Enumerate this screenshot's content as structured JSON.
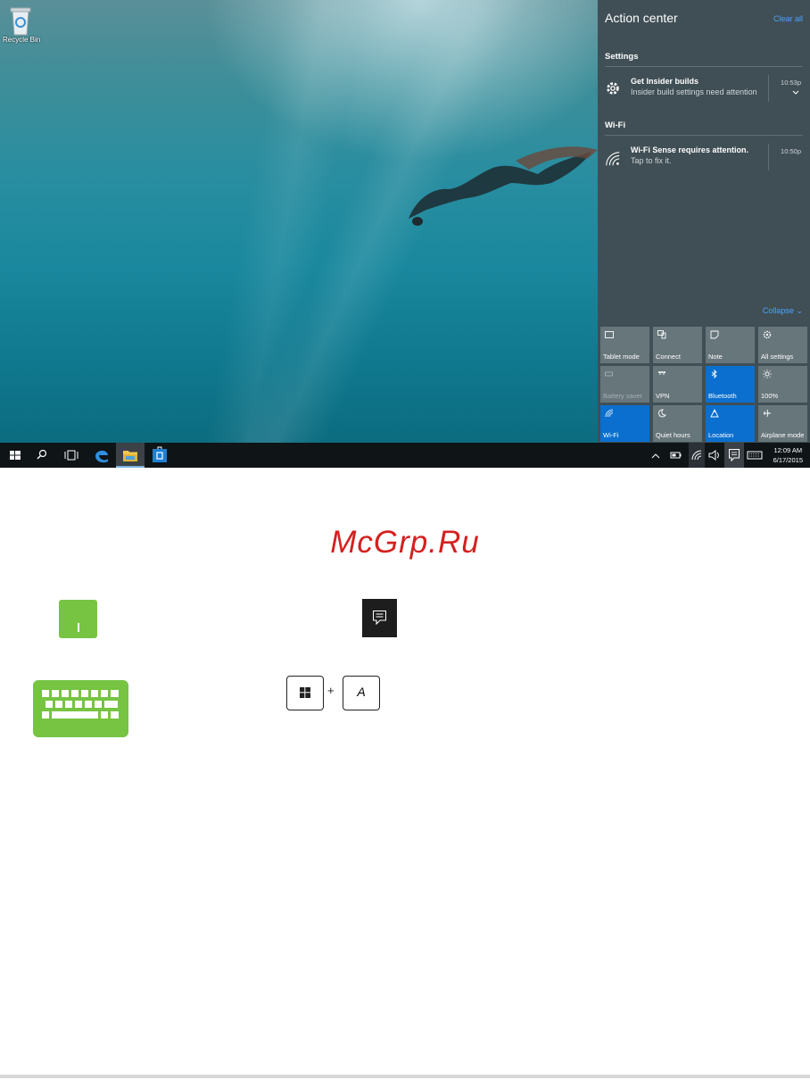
{
  "desktop": {
    "recycle_bin_label": "Recycle Bin"
  },
  "action_center": {
    "title": "Action center",
    "clear_all": "Clear all",
    "sections": [
      {
        "name": "Settings",
        "notification": {
          "icon": "gear-icon",
          "title": "Get Insider builds",
          "subtitle": "Insider build settings need attention",
          "time": "10:53p"
        }
      },
      {
        "name": "Wi-Fi",
        "notification": {
          "icon": "wifi-icon",
          "title": "Wi-Fi Sense requires attention.",
          "subtitle": "Tap to fix it.",
          "time": "10:50p"
        }
      }
    ],
    "collapse": "Collapse",
    "quick_actions": [
      {
        "label": "Tablet mode",
        "icon": "tablet-mode-icon",
        "active": false
      },
      {
        "label": "Connect",
        "icon": "connect-icon",
        "active": false
      },
      {
        "label": "Note",
        "icon": "note-icon",
        "active": false
      },
      {
        "label": "All settings",
        "icon": "settings-icon",
        "active": false
      },
      {
        "label": "Battery saver",
        "icon": "battery-icon",
        "active": false
      },
      {
        "label": "VPN",
        "icon": "vpn-icon",
        "active": false
      },
      {
        "label": "Bluetooth",
        "icon": "bluetooth-icon",
        "active": true
      },
      {
        "label": "100%",
        "icon": "brightness-icon",
        "active": false
      },
      {
        "label": "Wi-Fi",
        "icon": "wifi-icon",
        "active": true
      },
      {
        "label": "Quiet hours",
        "icon": "moon-icon",
        "active": false
      },
      {
        "label": "Location",
        "icon": "location-icon",
        "active": true
      },
      {
        "label": "Airplane mode",
        "icon": "airplane-icon",
        "active": false
      }
    ]
  },
  "taskbar": {
    "time": "12:09 AM",
    "date": "6/17/2015"
  },
  "watermark": "McGrp.Ru",
  "keyboard_shortcut": {
    "key": "A",
    "plus": "+"
  },
  "colors": {
    "accent_blue": "#0a6fcf",
    "green_icon": "#76c442",
    "watermark_red": "#d42020"
  }
}
